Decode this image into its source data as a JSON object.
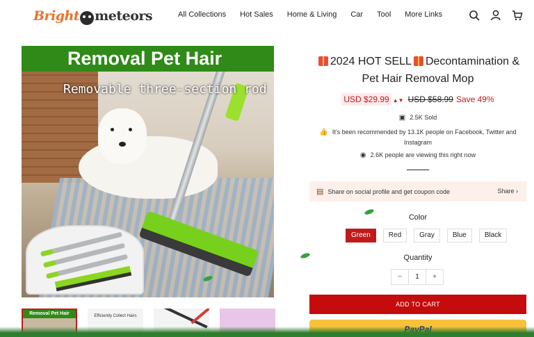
{
  "brand": {
    "part1": "Bright",
    "part2": "meteors"
  },
  "nav": {
    "items": [
      {
        "label": "All Collections"
      },
      {
        "label": "Hot Sales"
      },
      {
        "label": "Home & Living"
      },
      {
        "label": "Car"
      },
      {
        "label": "Tool"
      },
      {
        "label": "More Links"
      }
    ]
  },
  "header_icons": [
    "search-icon",
    "account-icon",
    "cart-icon"
  ],
  "hero": {
    "banner": "Removal Pet Hair",
    "subtitle": "Removable three-section rod"
  },
  "thumbnails": [
    {
      "caption": "Removal Pet Hair",
      "active": true
    },
    {
      "caption": "Efficiently Collect Hairs",
      "active": false
    },
    {
      "caption": "",
      "active": false
    },
    {
      "caption": "",
      "active": false
    }
  ],
  "product": {
    "title_prefix": "2024 HOT SELL",
    "title_rest": "Decontamination & Pet Hair Removal Mop",
    "price": "USD $29.99",
    "old_price": "USD $58.99",
    "save": "Save 49%",
    "sold": "2.5K Sold",
    "recommended": "It's been recommended by 13.1K people on Facebook, Twitter and Instagram",
    "viewing": "2.6K people are viewing this right now"
  },
  "share": {
    "text": "Share on social profile and get coupon code",
    "action": "Share"
  },
  "color": {
    "label": "Color",
    "options": [
      "Green",
      "Red",
      "Gray",
      "Blue",
      "Black"
    ],
    "selected": "Green"
  },
  "quantity": {
    "label": "Quantity",
    "minus": "−",
    "value": "1",
    "plus": "+"
  },
  "add_to_cart": "ADD TO CART",
  "paypal": "PayPal",
  "colors": {
    "accent": "#c11a1a",
    "cart_button": "#c40c0c",
    "paypal": "#f7c13a",
    "banner_green": "#2f8a17"
  }
}
